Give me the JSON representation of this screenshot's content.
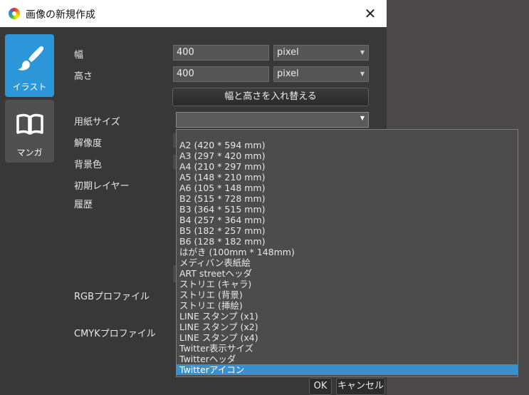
{
  "title_bar": {
    "title": "画像の新規作成",
    "close_symbol": "✕"
  },
  "mode_tabs": [
    {
      "label": "イラスト",
      "icon": "brush-icon",
      "active": true
    },
    {
      "label": "マンガ",
      "icon": "book-icon",
      "active": false
    }
  ],
  "form": {
    "width_label": "幅",
    "width_value": "400",
    "width_unit": "pixel",
    "height_label": "高さ",
    "height_value": "400",
    "height_unit": "pixel",
    "swap_button": "幅と高さを入れ替える",
    "paper_size_label": "用紙サイズ",
    "paper_size_value": "",
    "resolution_label": "解像度",
    "background_label": "背景色",
    "initial_layer_label": "初期レイヤー",
    "history_label": "履歴",
    "rgb_profile_label": "RGBプロファイル",
    "cmyk_profile_label": "CMYKプロファイル"
  },
  "paper_size_options": [
    "A2 (420 * 594 mm)",
    "A3 (297 * 420 mm)",
    "A4 (210 * 297 mm)",
    "A5 (148 * 210 mm)",
    "A6 (105 * 148 mm)",
    "B2 (515 * 728 mm)",
    "B3 (364 * 515 mm)",
    "B4 (257 * 364 mm)",
    "B5 (182 * 257 mm)",
    "B6 (128 * 182 mm)",
    "はがき (100mm * 148mm)",
    "メディバン表紙絵",
    "ART streetヘッダ",
    "ストリエ (キャラ)",
    "ストリエ (背景)",
    "ストリエ (挿絵)",
    "LINE スタンプ (x1)",
    "LINE スタンプ (x2)",
    "LINE スタンプ (x4)",
    "Twitter表示サイズ",
    "Twitterヘッダ",
    "Twitterアイコン"
  ],
  "selected_option_index": 21,
  "buttons": {
    "ok": "OK",
    "cancel": "キャンセル"
  },
  "colors": {
    "accent": "#2d96d9",
    "selection": "#3a8fcd",
    "dialog_bg": "#383838"
  }
}
